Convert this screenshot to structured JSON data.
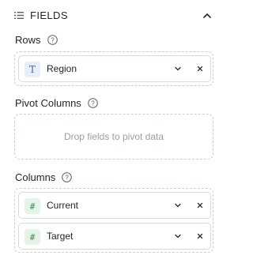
{
  "header": {
    "title": "FIELDS",
    "icon": "list-icon",
    "toggle_icon": "chevron-up-icon"
  },
  "rows": {
    "label": "Rows",
    "fields": [
      {
        "name": "Region",
        "type": "text"
      }
    ]
  },
  "pivot_columns": {
    "label": "Pivot Columns",
    "placeholder": "Drop fields to pivot data"
  },
  "columns": {
    "label": "Columns",
    "fields": [
      {
        "name": "Current",
        "type": "number"
      },
      {
        "name": "Target",
        "type": "number"
      }
    ]
  },
  "type_glyphs": {
    "text": "T",
    "number": "#"
  },
  "colors": {
    "text_badge": "#e6effa",
    "number_badge": "#e5f4e8",
    "border": "#c9ced6"
  }
}
